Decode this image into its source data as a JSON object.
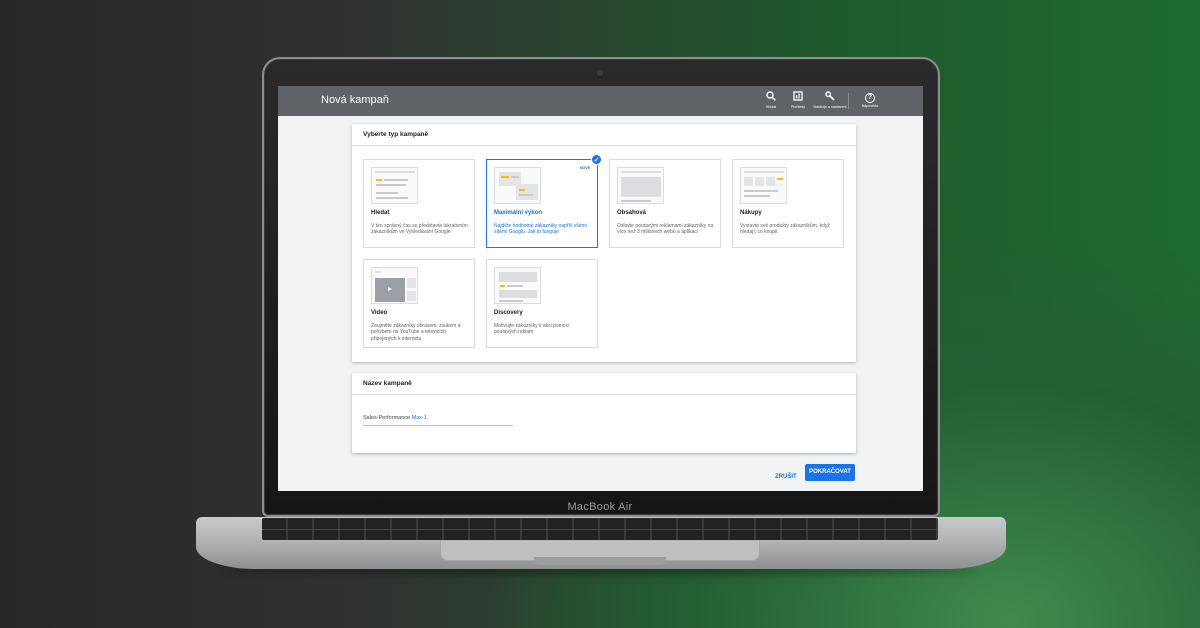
{
  "device": {
    "bezel_label": "MacBook Air"
  },
  "header": {
    "title": "Nová kampaň",
    "tools": [
      {
        "label": "Hledat",
        "icon": "search-icon"
      },
      {
        "label": "Přehledy",
        "icon": "reports-icon"
      },
      {
        "label": "Nástroje a nastavení",
        "icon": "wrench-icon"
      },
      {
        "label": "Nápověda",
        "icon": "help-icon"
      }
    ]
  },
  "campaign_type": {
    "title": "Vyberte typ kampaně",
    "types": [
      {
        "name": "Hledat",
        "description": "V ten správný čas se představte lukrativním zákazníkům ve Vyhledávání Google",
        "selected": false
      },
      {
        "name": "Maximální výkon",
        "badge": "NOVÉ",
        "description": "Najděte hodnotné zákazníky napříč všemi sítěmi Googlu. Jak to funguje",
        "selected": true
      },
      {
        "name": "Obsahová",
        "description": "Oslovte poutavými reklamami zákazníky na více než 3 milionech webů a aplikací",
        "selected": false
      },
      {
        "name": "Nákupy",
        "description": "Vystavte své produkty zákazníkům, když hledají, co koupit",
        "selected": false
      },
      {
        "name": "Video",
        "description": "Zaujměte zákazníky obrazem, zvukem a pohybem na YouTube a televizích připojených k internetu",
        "selected": false
      },
      {
        "name": "Discovery",
        "description": "Motivujte zákazníky k akci pomocí poutavých reklam",
        "selected": false
      }
    ]
  },
  "campaign_name": {
    "title": "Název kampaně",
    "value_prefix": "Sales-Performance ",
    "value_highlight": "Max-1"
  },
  "actions": {
    "cancel_label": "ZRUŠIT",
    "continue_label": "POKRAČOVAT"
  },
  "colors": {
    "accent": "#1a73e8",
    "header_bg": "#5f6368",
    "illustration_yellow": "#fbbc04"
  }
}
